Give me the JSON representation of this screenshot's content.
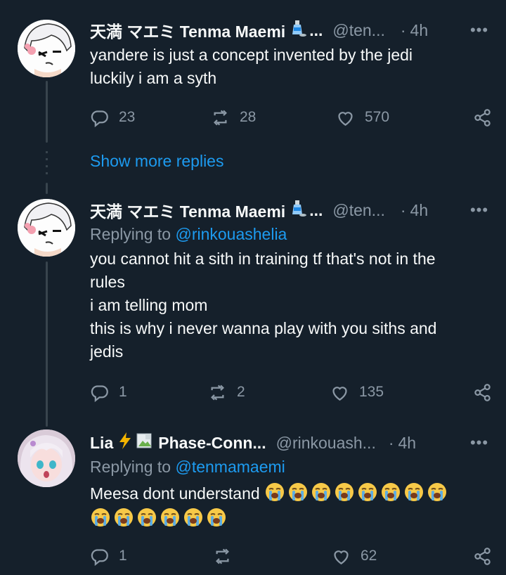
{
  "tweets": [
    {
      "name": "天満 マエミ Tenma Maemi",
      "name_suffix": "...",
      "handle": "@ten...",
      "time": "4h",
      "more": "•••",
      "body_lines": [
        "yandere is just a concept invented by the jedi",
        "luckily i am a syth"
      ],
      "replies": "23",
      "reposts": "28",
      "likes": "570"
    },
    {
      "name": "天満 マエミ Tenma Maemi",
      "name_suffix": "...",
      "handle": "@ten...",
      "time": "4h",
      "more": "•••",
      "replying_prefix": "Replying to ",
      "replying_to": "@rinkouashelia",
      "body_lines": [
        "you cannot hit a sith in training tf that's not in the",
        "rules",
        "i am telling mom",
        "this is why i never wanna play with you siths and",
        "jedis"
      ],
      "replies": "1",
      "reposts": "2",
      "likes": "135"
    },
    {
      "name": "Lia",
      "name_extra": "Phase-Conn...",
      "handle": "@rinkouash...",
      "time": "4h",
      "more": "•••",
      "replying_prefix": "Replying to ",
      "replying_to": "@tenmamaemi",
      "body_text": "Meesa dont understand",
      "replies": "1",
      "reposts": "",
      "likes": "62"
    }
  ],
  "show_more_replies": "Show more replies",
  "icons": {
    "reply": "reply-icon",
    "repost": "repost-icon",
    "like": "heart-icon",
    "share": "share-icon",
    "bottle": "sake-bottle-icon",
    "lightning": "lightning-icon",
    "broken_image": "broken-image-icon",
    "cry": "loudly-crying-face-icon"
  },
  "colors": {
    "background": "#15202b",
    "text": "#f7f9f9",
    "muted": "#8b98a5",
    "link": "#1d9bf0",
    "thread_line": "#38444d"
  }
}
